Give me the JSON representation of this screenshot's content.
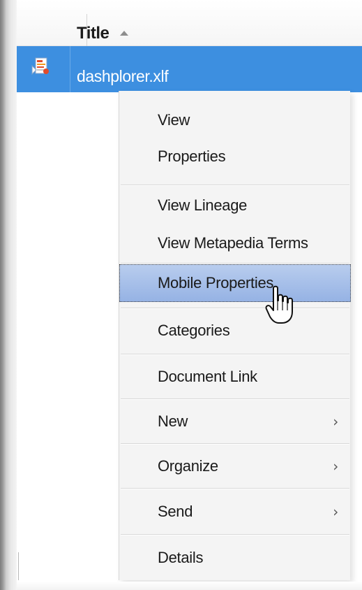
{
  "list": {
    "column_title": "Title",
    "sort_icon": "sort-ascending-icon",
    "selected_row": {
      "file_name": "dashplorer.xlf",
      "icon": "xlf-file-icon"
    },
    "selection_color": "#3d8fe0"
  },
  "context_menu": {
    "items": [
      {
        "label": "View"
      },
      {
        "label": "Properties"
      },
      {
        "label": "View Lineage"
      },
      {
        "label": "View Metapedia Terms"
      },
      {
        "label": "Mobile Properties",
        "state": "hovered"
      },
      {
        "label": "Categories"
      },
      {
        "label": "Document Link"
      },
      {
        "label": "New",
        "submenu_icon": "chevron-right-icon",
        "submenu_glyph": "›"
      },
      {
        "label": "Organize",
        "submenu_icon": "chevron-right-icon",
        "submenu_glyph": "›"
      },
      {
        "label": "Send",
        "submenu_icon": "chevron-right-icon",
        "submenu_glyph": "›"
      },
      {
        "label": "Details"
      }
    ],
    "hover_color": "#a9c2ec"
  },
  "cursor": {
    "icon": "hand-pointer-icon"
  }
}
